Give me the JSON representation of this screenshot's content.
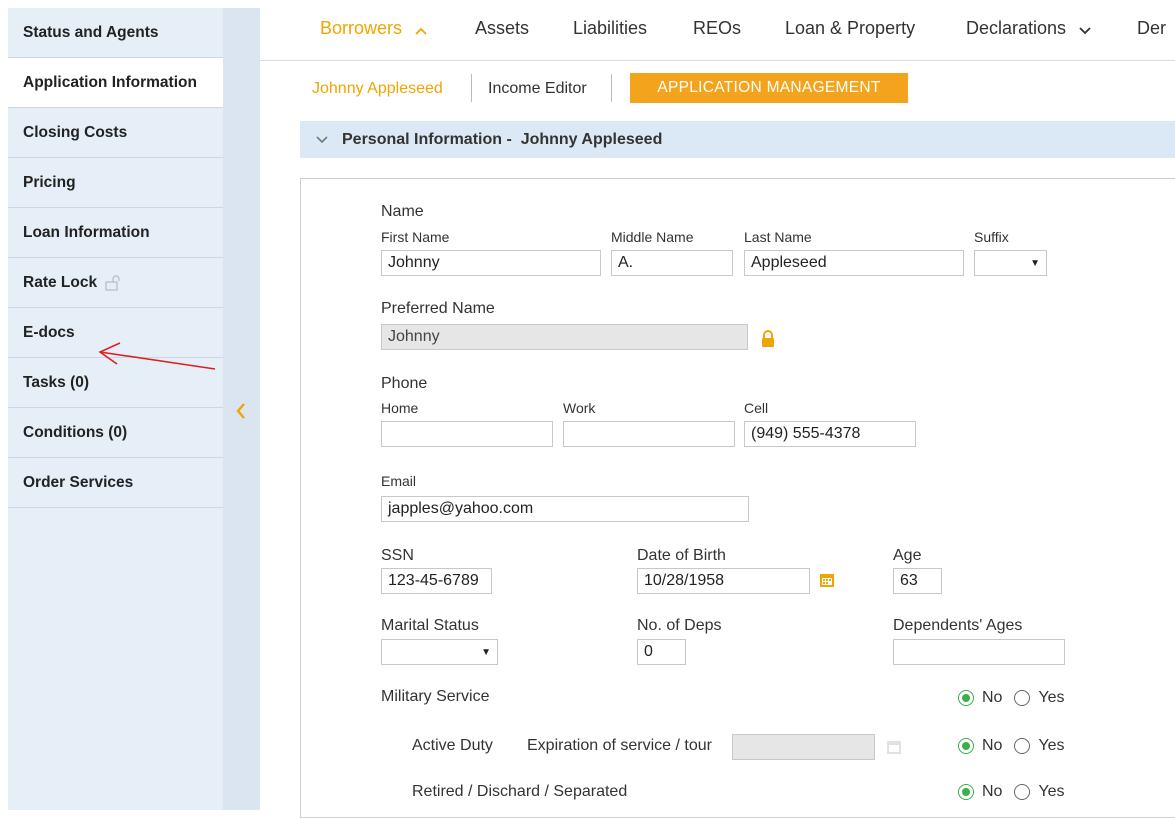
{
  "sidebar": {
    "items": [
      {
        "label": "Status and Agents"
      },
      {
        "label": "Application Information"
      },
      {
        "label": "Closing Costs"
      },
      {
        "label": "Pricing"
      },
      {
        "label": "Loan Information"
      },
      {
        "label": "Rate Lock"
      },
      {
        "label": "E-docs"
      },
      {
        "label": "Tasks (0)"
      },
      {
        "label": "Conditions (0)"
      },
      {
        "label": "Order Services"
      }
    ]
  },
  "nav": {
    "tabs": [
      {
        "label": "Borrowers"
      },
      {
        "label": "Assets"
      },
      {
        "label": "Liabilities"
      },
      {
        "label": "REOs"
      },
      {
        "label": "Loan & Property"
      },
      {
        "label": "Declarations"
      },
      {
        "label": "Der"
      }
    ]
  },
  "subnav": {
    "borrower": "Johnny Appleseed",
    "income_editor": "Income Editor",
    "app_management": "APPLICATION MANAGEMENT"
  },
  "section": {
    "title": "Personal Information -  Johnny Appleseed"
  },
  "form": {
    "name_label": "Name",
    "first_name_label": "First Name",
    "first_name": "Johnny",
    "middle_name_label": "Middle Name",
    "middle_name": "A.",
    "last_name_label": "Last Name",
    "last_name": "Appleseed",
    "suffix_label": "Suffix",
    "suffix": "",
    "preferred_name_label": "Preferred Name",
    "preferred_name": "Johnny",
    "phone_label": "Phone",
    "home_label": "Home",
    "home": "",
    "work_label": "Work",
    "work": "",
    "cell_label": "Cell",
    "cell": "(949) 555-4378",
    "email_label": "Email",
    "email": "japples@yahoo.com",
    "ssn_label": "SSN",
    "ssn": "123-45-6789",
    "dob_label": "Date of Birth",
    "dob": "10/28/1958",
    "age_label": "Age",
    "age": "63",
    "marital_label": "Marital Status",
    "marital": "",
    "deps_label": "No. of Deps",
    "deps": "0",
    "dep_ages_label": "Dependents' Ages",
    "dep_ages": "",
    "military_label": "Military Service",
    "active_duty_label": "Active Duty",
    "expiration_label": "Expiration of service / tour",
    "expiration": "",
    "retired_label": "Retired / Dischard / Separated",
    "no_label": "No",
    "yes_label": "Yes"
  },
  "colors": {
    "accent": "#f0a500",
    "button": "#f4a41c",
    "sidebar_bg": "#e6eef8",
    "section_bg": "#dbe9f6",
    "radio_checked": "#3cae4a",
    "annotation_arrow": "#e02020"
  }
}
